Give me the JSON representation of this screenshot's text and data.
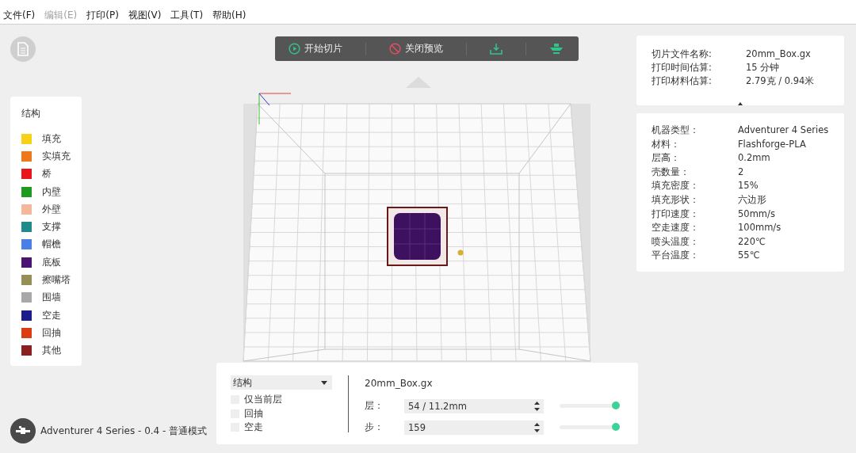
{
  "menu": [
    {
      "label": "文件(F)",
      "disabled": false
    },
    {
      "label": "编辑(E)",
      "disabled": true
    },
    {
      "label": "打印(P)",
      "disabled": false
    },
    {
      "label": "视图(V)",
      "disabled": false
    },
    {
      "label": "工具(T)",
      "disabled": false
    },
    {
      "label": "帮助(H)",
      "disabled": false
    }
  ],
  "toolbar": [
    {
      "kind": "start-slice",
      "label": "开始切片"
    },
    {
      "kind": "close-preview",
      "label": "关闭预览"
    },
    {
      "kind": "export"
    },
    {
      "kind": "print"
    }
  ],
  "legend": {
    "title": "结构",
    "items": [
      {
        "label": "填充",
        "color": "#f7d117"
      },
      {
        "label": "实填充",
        "color": "#f07818"
      },
      {
        "label": "桥",
        "color": "#e8151a"
      },
      {
        "label": "内壁",
        "color": "#1e9a1e"
      },
      {
        "label": "外壁",
        "color": "#f5b79a"
      },
      {
        "label": "支撑",
        "color": "#1e8a8c"
      },
      {
        "label": "帽檐",
        "color": "#4a7fe8"
      },
      {
        "label": "底板",
        "color": "#4a1470"
      },
      {
        "label": "擦嘴塔",
        "color": "#948f54"
      },
      {
        "label": "围墙",
        "color": "#a8a8a8"
      },
      {
        "label": "空走",
        "color": "#1c1c8c"
      },
      {
        "label": "回抽",
        "color": "#dc3c14"
      },
      {
        "label": "其他",
        "color": "#8c2020"
      }
    ]
  },
  "summary": [
    {
      "label": "切片文件名称:",
      "value": "20mm_Box.gx"
    },
    {
      "label": "打印时间估算:",
      "value": "15 分钟"
    },
    {
      "label": "打印材料估算:",
      "value": "2.79克 / 0.94米"
    }
  ],
  "details": [
    {
      "label": "机器类型：",
      "value": "Adventurer 4 Series"
    },
    {
      "label": "材料：",
      "value": "Flashforge-PLA"
    },
    {
      "label": "层高：",
      "value": "0.2mm"
    },
    {
      "label": "壳数量：",
      "value": "2"
    },
    {
      "label": "填充密度：",
      "value": "15%"
    },
    {
      "label": "填充形状：",
      "value": "六边形"
    },
    {
      "label": "打印速度：",
      "value": "50mm/s"
    },
    {
      "label": "空走速度：",
      "value": "100mm/s"
    },
    {
      "label": "喷头温度：",
      "value": "220℃"
    },
    {
      "label": "平台温度：",
      "value": "55℃"
    }
  ],
  "preview": {
    "view_select": "结构",
    "options": [
      {
        "label": "仅当前层",
        "checked": false
      },
      {
        "label": "回抽",
        "checked": false
      },
      {
        "label": "空走",
        "checked": false
      }
    ],
    "file_name": "20mm_Box.gx",
    "sliders": [
      {
        "label": "层：",
        "value": "54 / 11.2mm",
        "level": 1
      },
      {
        "label": "步：",
        "value": "159",
        "level": 1
      }
    ]
  },
  "status_bar": "Adventurer 4 Series - 0.4 - 普通模式"
}
